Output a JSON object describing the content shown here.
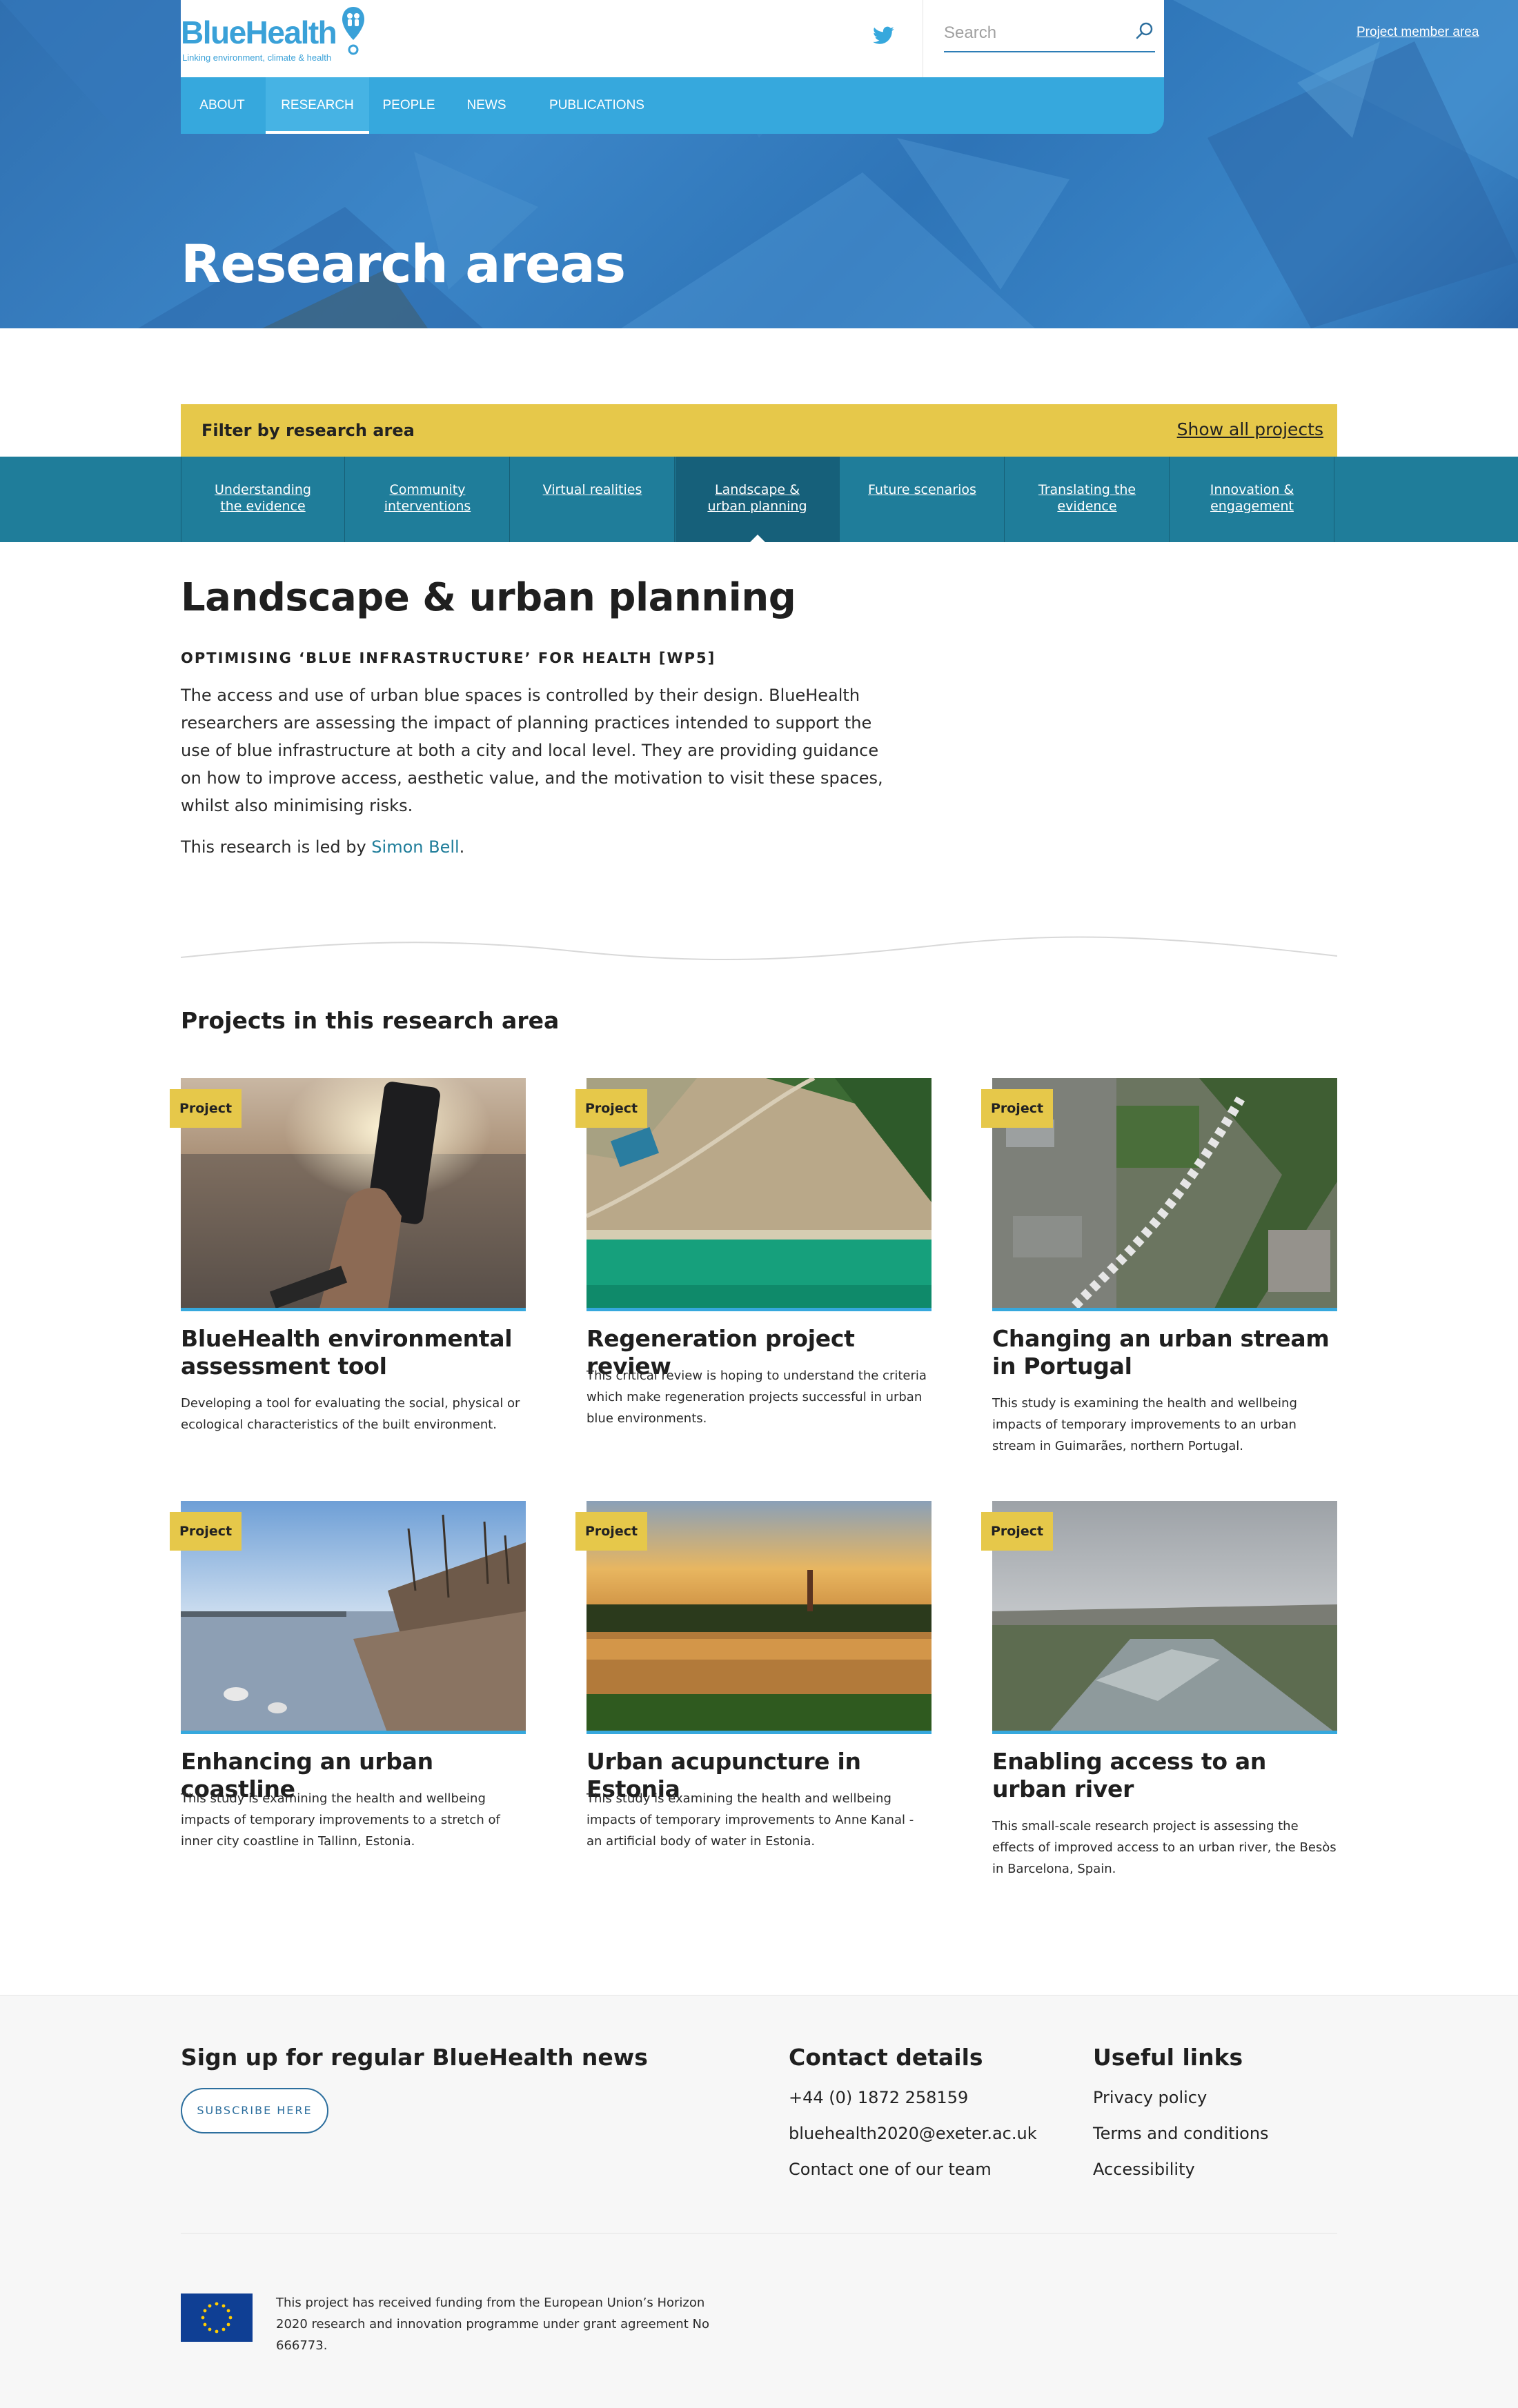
{
  "header": {
    "logo_text": "BlueHealth",
    "logo_tagline": "Linking environment, climate & health",
    "member_link": "Project member area",
    "search_placeholder": "Search"
  },
  "nav": {
    "items": [
      {
        "label": "ABOUT"
      },
      {
        "label": "RESEARCH"
      },
      {
        "label": "PEOPLE"
      },
      {
        "label": "NEWS"
      },
      {
        "label": "PUBLICATIONS"
      }
    ],
    "active": "RESEARCH"
  },
  "hero": {
    "title": "Research areas"
  },
  "filter": {
    "label": "Filter by research area",
    "show_all": "Show all projects",
    "tabs": [
      {
        "line1": "Understanding",
        "line2": "the evidence"
      },
      {
        "line1": "Community",
        "line2": "interventions"
      },
      {
        "line1": "Virtual realities",
        "line2": ""
      },
      {
        "line1": "Landscape &",
        "line2": "urban planning"
      },
      {
        "line1": "Future scenarios",
        "line2": ""
      },
      {
        "line1": "Translating the",
        "line2": "evidence"
      },
      {
        "line1": "Innovation &",
        "line2": "engagement"
      }
    ],
    "active_tab": "Landscape & urban planning"
  },
  "article": {
    "title": "Landscape & urban planning",
    "subtitle": "OPTIMISING ‘BLUE INFRASTRUCTURE’ FOR HEALTH [WP5]",
    "body": "The access and use of urban blue spaces is controlled by their design. BlueHealth researchers are assessing the impact of planning practices intended to support the use of blue infrastructure at both a city and local level. They are providing guidance on how to improve access, aesthetic value, and the motivation to visit these spaces, whilst also minimising risks.",
    "led_prefix": "This research is led by ",
    "led_name": "Simon Bell",
    "led_suffix": "."
  },
  "projects": {
    "heading": "Projects in this research area",
    "badge": "Project",
    "cards": [
      {
        "title": "BlueHealth environmental assessment tool",
        "desc": "Developing a tool for evaluating the social, physical or ecological characteristics of the built environment."
      },
      {
        "title": "Regeneration project review",
        "desc": "This critical review is hoping to understand the criteria which make regeneration projects successful in urban blue environments."
      },
      {
        "title": "Changing an urban stream in Portugal",
        "desc": "This study is examining the health and wellbeing impacts of temporary improvements to an urban stream in Guimarães, northern Portugal."
      },
      {
        "title": "Enhancing an urban coastline",
        "desc": "This study is examining the health and wellbeing impacts of temporary improvements to a stretch of inner city coastline in Tallinn, Estonia."
      },
      {
        "title": "Urban acupuncture in Estonia",
        "desc": "This study is examining the health and wellbeing impacts of temporary improvements to Anne Kanal - an artificial body of water in Estonia."
      },
      {
        "title": "Enabling access to an urban river",
        "desc": "This small-scale research project is assessing the effects of improved access to an urban river, the Besòs in Barcelona, Spain."
      }
    ]
  },
  "footer": {
    "signup_heading": "Sign up for regular BlueHealth news",
    "subscribe_label": "SUBSCRIBE HERE",
    "contact_heading": "Contact details",
    "phone": "+44 (0) 1872 258159",
    "email": "bluehealth2020@exeter.ac.uk",
    "contact_team": "Contact one of our team",
    "links_heading": "Useful links",
    "links": [
      "Privacy policy",
      "Terms and conditions",
      "Accessibility"
    ],
    "eu_text": "This project has received funding from the European Union’s Horizon 2020 research and innovation programme under grant agreement No 666773."
  }
}
